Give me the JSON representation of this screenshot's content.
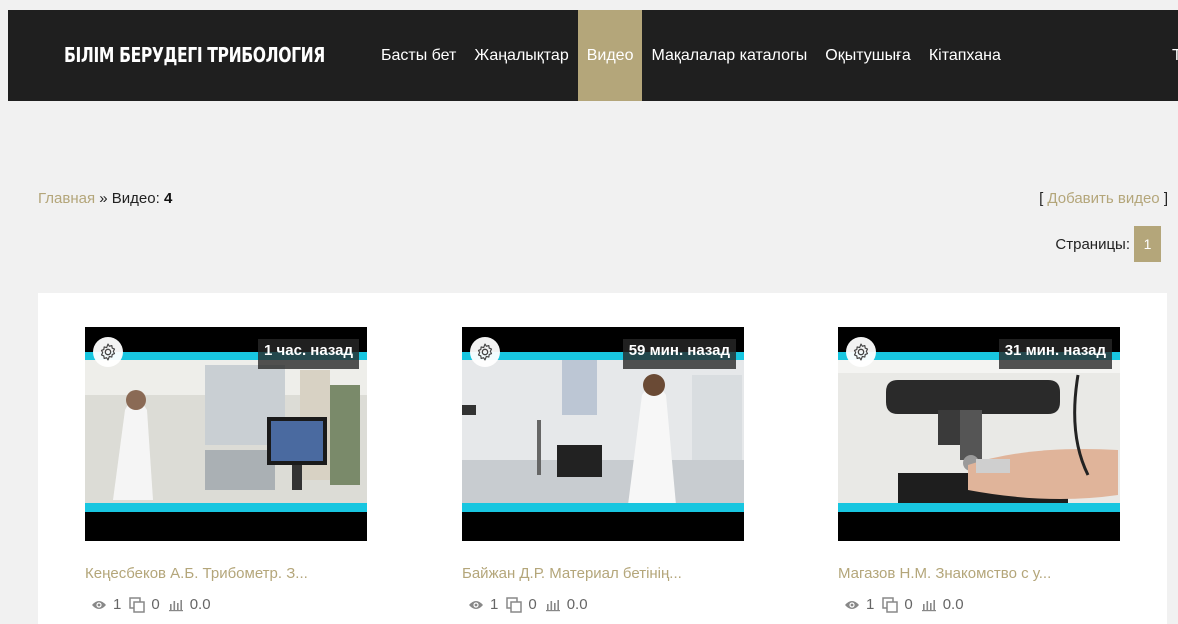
{
  "header": {
    "brand": "БІЛІМ БЕРУДЕГІ ТРИБОЛОГИЯ",
    "nav": [
      {
        "label": "Басты бет",
        "active": false
      },
      {
        "label": "Жаңалықтар",
        "active": false
      },
      {
        "label": "Видео",
        "active": true
      },
      {
        "label": "Мақалалар каталогы",
        "active": false
      },
      {
        "label": "Оқытушыға",
        "active": false
      },
      {
        "label": "Кітапхана",
        "active": false
      }
    ],
    "overflow_char": "Т"
  },
  "breadcrumb": {
    "home": "Главная",
    "separator": " » ",
    "current": "Видео: ",
    "count": "4"
  },
  "add_video": {
    "open": "[ ",
    "label": "Добавить видео",
    "close": " ]"
  },
  "pagination": {
    "label": "Страницы:",
    "pages": [
      "1"
    ]
  },
  "videos": [
    {
      "title": "Кеңесбеков А.Б. Трибометр. З...",
      "time": "1 час. назад",
      "views": "1",
      "comments": "0",
      "rating": "0.0"
    },
    {
      "title": "Байжан Д.Р. Материал бетінің...",
      "time": "59 мин. назад",
      "views": "1",
      "comments": "0",
      "rating": "0.0"
    },
    {
      "title": "Магазов Н.М. Знакомство с у...",
      "time": "31 мин. назад",
      "views": "1",
      "comments": "0",
      "rating": "0.0"
    }
  ],
  "colors": {
    "accent": "#b4a67a",
    "header_bg": "#1f1f1f",
    "page_bg": "#f1f1f1",
    "video_stripe": "#18c6e0"
  },
  "icons": {
    "settings": "gear-icon",
    "views": "eye-icon",
    "comments": "comments-icon",
    "rating": "rating-bars-icon"
  }
}
